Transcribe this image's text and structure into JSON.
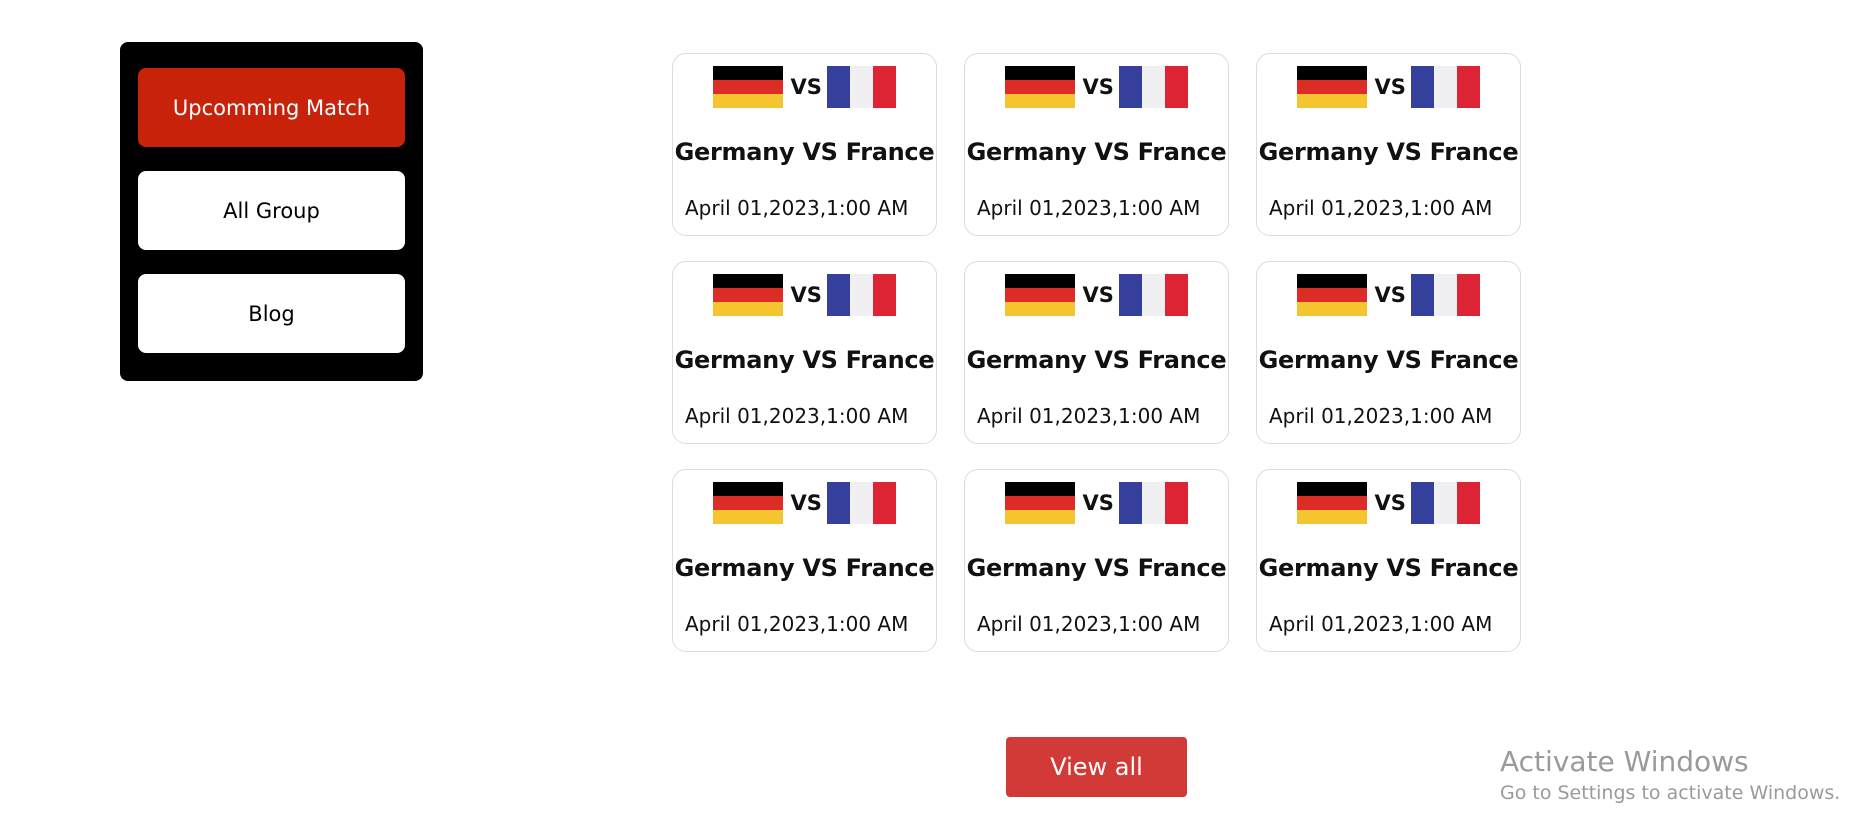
{
  "sidebar": {
    "items": [
      {
        "label": "Upcomming Match",
        "active": true
      },
      {
        "label": "All Group",
        "active": false
      },
      {
        "label": "Blog",
        "active": false
      }
    ]
  },
  "colors": {
    "accent_active": "#c9220a",
    "view_all_bg": "#d23a37",
    "germany_flag": [
      "#000000",
      "#dd2c25",
      "#f4c530"
    ],
    "france_flag": [
      "#34409b",
      "#f0f0f3",
      "#dc2434"
    ]
  },
  "matches": [
    {
      "team_a": "Germany",
      "team_b": "France",
      "vs_label": "VS",
      "title": "Germany VS France",
      "date": "April 01,2023,1:00 AM"
    },
    {
      "team_a": "Germany",
      "team_b": "France",
      "vs_label": "VS",
      "title": "Germany VS France",
      "date": "April 01,2023,1:00 AM"
    },
    {
      "team_a": "Germany",
      "team_b": "France",
      "vs_label": "VS",
      "title": "Germany VS France",
      "date": "April 01,2023,1:00 AM"
    },
    {
      "team_a": "Germany",
      "team_b": "France",
      "vs_label": "VS",
      "title": "Germany VS France",
      "date": "April 01,2023,1:00 AM"
    },
    {
      "team_a": "Germany",
      "team_b": "France",
      "vs_label": "VS",
      "title": "Germany VS France",
      "date": "April 01,2023,1:00 AM"
    },
    {
      "team_a": "Germany",
      "team_b": "France",
      "vs_label": "VS",
      "title": "Germany VS France",
      "date": "April 01,2023,1:00 AM"
    },
    {
      "team_a": "Germany",
      "team_b": "France",
      "vs_label": "VS",
      "title": "Germany VS France",
      "date": "April 01,2023,1:00 AM"
    },
    {
      "team_a": "Germany",
      "team_b": "France",
      "vs_label": "VS",
      "title": "Germany VS France",
      "date": "April 01,2023,1:00 AM"
    },
    {
      "team_a": "Germany",
      "team_b": "France",
      "vs_label": "VS",
      "title": "Germany VS France",
      "date": "April 01,2023,1:00 AM"
    }
  ],
  "view_all_label": "View all",
  "watermark": {
    "title": "Activate Windows",
    "subtitle": "Go to Settings to activate Windows."
  }
}
